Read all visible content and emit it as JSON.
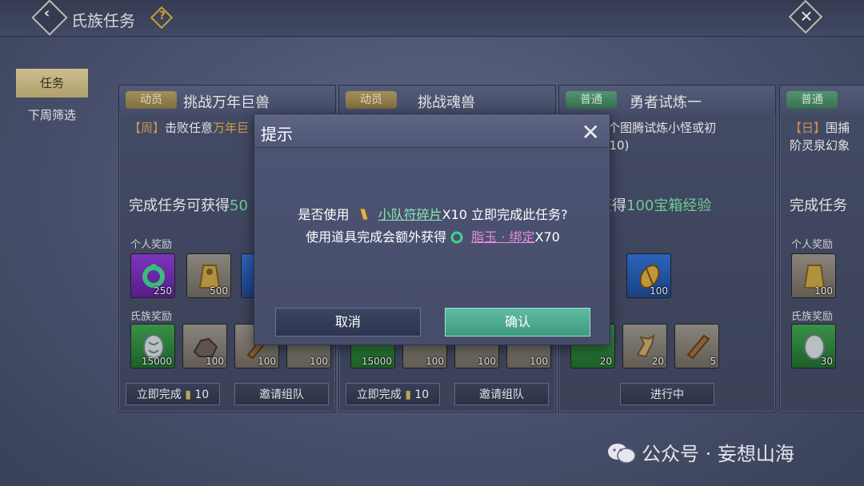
{
  "header": {
    "title": "氏族任务",
    "help_icon": "question-diamond-icon"
  },
  "sidebar": {
    "items": [
      {
        "label": "任务",
        "active": true
      },
      {
        "label": "下周筛选",
        "active": false
      }
    ]
  },
  "cards": [
    {
      "badge": "动员",
      "badge_color": "#b9a062",
      "title": "挑战万年巨兽",
      "desc_tag": "【周】",
      "desc_text": "击败任意",
      "desc_highlight": "万年巨",
      "reward_prefix": "完成任务可获得",
      "reward_num": "50",
      "personal_label": "个人奖励",
      "personal_items": [
        "250",
        "500"
      ],
      "clan_label": "氏族奖励",
      "clan_items": [
        "15000",
        "100",
        "100",
        "100"
      ],
      "btn1_label": "立即完成",
      "btn1_count": "10",
      "btn2_label": "邀请组队"
    },
    {
      "badge": "动员",
      "title": "挑战魂兽",
      "clan_items": [
        "15000",
        "100",
        "100",
        "100"
      ],
      "btn1_label": "立即完成",
      "btn1_count": "10",
      "btn2_label": "邀请组队"
    },
    {
      "badge": "普通",
      "badge_color": "#5aa67c",
      "title": "勇者试炼一",
      "desc_line1": "围捕10个图腾试炼小怪或初",
      "desc_line2": "幻象(0/10)",
      "reward_prefix": "务可获得",
      "reward_num": "100宝箱经验",
      "personal_label": "励",
      "personal_items": [
        "100"
      ],
      "clan_label": "励",
      "clan_items": [
        "20",
        "20",
        "5"
      ],
      "btn2_label": "进行中"
    },
    {
      "badge": "普通",
      "desc_tag": "【日】",
      "desc_line1": "围捕",
      "desc_line2": "阶灵泉幻象",
      "reward_prefix": "完成任务",
      "personal_label": "个人奖励",
      "personal_items": [
        "100"
      ],
      "clan_label": "氏族奖励",
      "clan_items": [
        "30"
      ]
    }
  ],
  "dialog": {
    "title": "提示",
    "line1_pre": "是否使用",
    "line1_item": "小队符碎片",
    "line1_post": "X10 立即完成此任务?",
    "line2_pre": "使用道具完成会额外获得",
    "line2_item": "脂玉 · 绑定",
    "line2_post": "X70",
    "cancel_label": "取消",
    "confirm_label": "确认"
  },
  "watermark": {
    "text": "公众号 · 妄想山海"
  }
}
